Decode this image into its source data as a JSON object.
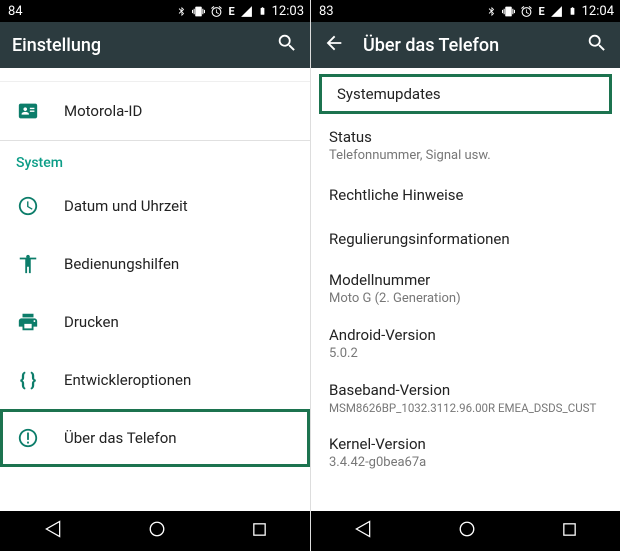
{
  "left": {
    "status": {
      "battery": "84",
      "time": "12:03",
      "net": "E"
    },
    "appbar": {
      "title": "Einstellung"
    },
    "items": {
      "motorola_id": "Motorola-ID",
      "section_system": "System",
      "date_time": "Datum und Uhrzeit",
      "accessibility": "Bedienungshilfen",
      "printing": "Drucken",
      "dev_options": "Entwickleroptionen",
      "about_phone": "Über das Telefon"
    }
  },
  "right": {
    "status": {
      "battery": "83",
      "time": "12:04",
      "net": "E"
    },
    "appbar": {
      "title": "Über das Telefon"
    },
    "items": {
      "system_updates": "Systemupdates",
      "status_label": "Status",
      "status_sub": "Telefonnummer, Signal usw.",
      "legal": "Rechtliche Hinweise",
      "regulatory": "Regulierungsinformationen",
      "model_label": "Modellnummer",
      "model_value": "Moto G (2. Generation)",
      "android_label": "Android-Version",
      "android_value": "5.0.2",
      "baseband_label": "Baseband-Version",
      "baseband_value": "MSM8626BP_1032.3112.96.00R EMEA_DSDS_CUST",
      "kernel_label": "Kernel-Version",
      "kernel_value": "3.4.42-g0bea67a"
    }
  }
}
